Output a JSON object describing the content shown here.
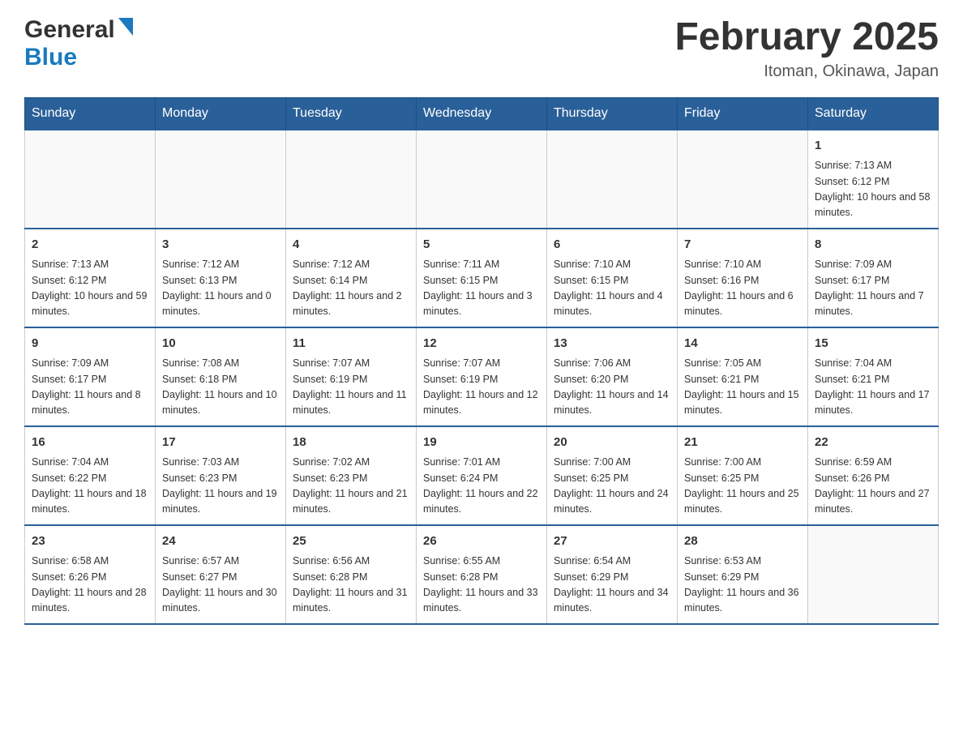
{
  "header": {
    "logo_general": "General",
    "logo_blue": "Blue",
    "month_title": "February 2025",
    "location": "Itoman, Okinawa, Japan"
  },
  "weekdays": [
    "Sunday",
    "Monday",
    "Tuesday",
    "Wednesday",
    "Thursday",
    "Friday",
    "Saturday"
  ],
  "weeks": [
    [
      {
        "day": "",
        "sunrise": "",
        "sunset": "",
        "daylight": ""
      },
      {
        "day": "",
        "sunrise": "",
        "sunset": "",
        "daylight": ""
      },
      {
        "day": "",
        "sunrise": "",
        "sunset": "",
        "daylight": ""
      },
      {
        "day": "",
        "sunrise": "",
        "sunset": "",
        "daylight": ""
      },
      {
        "day": "",
        "sunrise": "",
        "sunset": "",
        "daylight": ""
      },
      {
        "day": "",
        "sunrise": "",
        "sunset": "",
        "daylight": ""
      },
      {
        "day": "1",
        "sunrise": "Sunrise: 7:13 AM",
        "sunset": "Sunset: 6:12 PM",
        "daylight": "Daylight: 10 hours and 58 minutes."
      }
    ],
    [
      {
        "day": "2",
        "sunrise": "Sunrise: 7:13 AM",
        "sunset": "Sunset: 6:12 PM",
        "daylight": "Daylight: 10 hours and 59 minutes."
      },
      {
        "day": "3",
        "sunrise": "Sunrise: 7:12 AM",
        "sunset": "Sunset: 6:13 PM",
        "daylight": "Daylight: 11 hours and 0 minutes."
      },
      {
        "day": "4",
        "sunrise": "Sunrise: 7:12 AM",
        "sunset": "Sunset: 6:14 PM",
        "daylight": "Daylight: 11 hours and 2 minutes."
      },
      {
        "day": "5",
        "sunrise": "Sunrise: 7:11 AM",
        "sunset": "Sunset: 6:15 PM",
        "daylight": "Daylight: 11 hours and 3 minutes."
      },
      {
        "day": "6",
        "sunrise": "Sunrise: 7:10 AM",
        "sunset": "Sunset: 6:15 PM",
        "daylight": "Daylight: 11 hours and 4 minutes."
      },
      {
        "day": "7",
        "sunrise": "Sunrise: 7:10 AM",
        "sunset": "Sunset: 6:16 PM",
        "daylight": "Daylight: 11 hours and 6 minutes."
      },
      {
        "day": "8",
        "sunrise": "Sunrise: 7:09 AM",
        "sunset": "Sunset: 6:17 PM",
        "daylight": "Daylight: 11 hours and 7 minutes."
      }
    ],
    [
      {
        "day": "9",
        "sunrise": "Sunrise: 7:09 AM",
        "sunset": "Sunset: 6:17 PM",
        "daylight": "Daylight: 11 hours and 8 minutes."
      },
      {
        "day": "10",
        "sunrise": "Sunrise: 7:08 AM",
        "sunset": "Sunset: 6:18 PM",
        "daylight": "Daylight: 11 hours and 10 minutes."
      },
      {
        "day": "11",
        "sunrise": "Sunrise: 7:07 AM",
        "sunset": "Sunset: 6:19 PM",
        "daylight": "Daylight: 11 hours and 11 minutes."
      },
      {
        "day": "12",
        "sunrise": "Sunrise: 7:07 AM",
        "sunset": "Sunset: 6:19 PM",
        "daylight": "Daylight: 11 hours and 12 minutes."
      },
      {
        "day": "13",
        "sunrise": "Sunrise: 7:06 AM",
        "sunset": "Sunset: 6:20 PM",
        "daylight": "Daylight: 11 hours and 14 minutes."
      },
      {
        "day": "14",
        "sunrise": "Sunrise: 7:05 AM",
        "sunset": "Sunset: 6:21 PM",
        "daylight": "Daylight: 11 hours and 15 minutes."
      },
      {
        "day": "15",
        "sunrise": "Sunrise: 7:04 AM",
        "sunset": "Sunset: 6:21 PM",
        "daylight": "Daylight: 11 hours and 17 minutes."
      }
    ],
    [
      {
        "day": "16",
        "sunrise": "Sunrise: 7:04 AM",
        "sunset": "Sunset: 6:22 PM",
        "daylight": "Daylight: 11 hours and 18 minutes."
      },
      {
        "day": "17",
        "sunrise": "Sunrise: 7:03 AM",
        "sunset": "Sunset: 6:23 PM",
        "daylight": "Daylight: 11 hours and 19 minutes."
      },
      {
        "day": "18",
        "sunrise": "Sunrise: 7:02 AM",
        "sunset": "Sunset: 6:23 PM",
        "daylight": "Daylight: 11 hours and 21 minutes."
      },
      {
        "day": "19",
        "sunrise": "Sunrise: 7:01 AM",
        "sunset": "Sunset: 6:24 PM",
        "daylight": "Daylight: 11 hours and 22 minutes."
      },
      {
        "day": "20",
        "sunrise": "Sunrise: 7:00 AM",
        "sunset": "Sunset: 6:25 PM",
        "daylight": "Daylight: 11 hours and 24 minutes."
      },
      {
        "day": "21",
        "sunrise": "Sunrise: 7:00 AM",
        "sunset": "Sunset: 6:25 PM",
        "daylight": "Daylight: 11 hours and 25 minutes."
      },
      {
        "day": "22",
        "sunrise": "Sunrise: 6:59 AM",
        "sunset": "Sunset: 6:26 PM",
        "daylight": "Daylight: 11 hours and 27 minutes."
      }
    ],
    [
      {
        "day": "23",
        "sunrise": "Sunrise: 6:58 AM",
        "sunset": "Sunset: 6:26 PM",
        "daylight": "Daylight: 11 hours and 28 minutes."
      },
      {
        "day": "24",
        "sunrise": "Sunrise: 6:57 AM",
        "sunset": "Sunset: 6:27 PM",
        "daylight": "Daylight: 11 hours and 30 minutes."
      },
      {
        "day": "25",
        "sunrise": "Sunrise: 6:56 AM",
        "sunset": "Sunset: 6:28 PM",
        "daylight": "Daylight: 11 hours and 31 minutes."
      },
      {
        "day": "26",
        "sunrise": "Sunrise: 6:55 AM",
        "sunset": "Sunset: 6:28 PM",
        "daylight": "Daylight: 11 hours and 33 minutes."
      },
      {
        "day": "27",
        "sunrise": "Sunrise: 6:54 AM",
        "sunset": "Sunset: 6:29 PM",
        "daylight": "Daylight: 11 hours and 34 minutes."
      },
      {
        "day": "28",
        "sunrise": "Sunrise: 6:53 AM",
        "sunset": "Sunset: 6:29 PM",
        "daylight": "Daylight: 11 hours and 36 minutes."
      },
      {
        "day": "",
        "sunrise": "",
        "sunset": "",
        "daylight": ""
      }
    ]
  ]
}
